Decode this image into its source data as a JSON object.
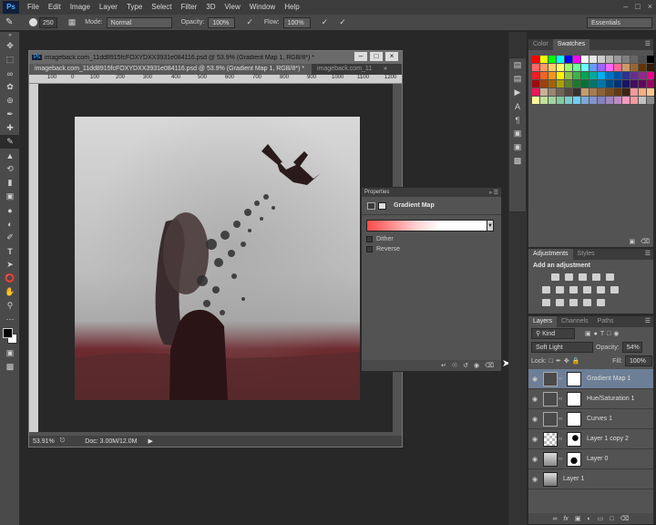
{
  "menu": {
    "logo": "Ps",
    "items": [
      "File",
      "Edit",
      "Image",
      "Layer",
      "Type",
      "Select",
      "Filter",
      "3D",
      "View",
      "Window",
      "Help"
    ]
  },
  "options": {
    "brush_size": "250",
    "mode_label": "Mode:",
    "mode_value": "Normal",
    "opacity_label": "Opacity:",
    "opacity_value": "100%",
    "flow_label": "Flow:",
    "flow_value": "100%",
    "workspace": "Essentials"
  },
  "document": {
    "window_title": "imageback.com_11dd8915fcFOXYDXX3931e084116.psd @ 53.9% (Gradient Map 1, RGB/8*) *",
    "tabs": [
      {
        "label": "imageback.com_11dd8915fcFOXYDXX3931e084116.psd @ 53.9% (Gradient Map 1, RGB/8*) *",
        "active": true
      },
      {
        "label": "imageback.com_11",
        "active": false
      }
    ],
    "ruler_ticks": [
      "100",
      "0",
      "100",
      "200",
      "300",
      "400",
      "500",
      "600",
      "700",
      "800",
      "900",
      "1000",
      "1100",
      "1200"
    ],
    "zoom": "53.91%",
    "doc_size": "Doc: 3.00M/12.0M"
  },
  "properties": {
    "panel_title": "Properties",
    "adjustment_name": "Gradient Map",
    "dither_label": "Dither",
    "reverse_label": "Reverse",
    "gradient_colors": [
      "#ff4a4a",
      "#ffffff"
    ]
  },
  "swatches_panel": {
    "tabs": [
      "Color",
      "Swatches"
    ],
    "active_tab": "Swatches",
    "colors": [
      "#ff0000",
      "#ffff00",
      "#00ff00",
      "#00ffff",
      "#0000ff",
      "#ff00ff",
      "#ffffff",
      "#e6e6e6",
      "#cccccc",
      "#b3b3b3",
      "#999999",
      "#808080",
      "#666666",
      "#4d4d4d",
      "#000000",
      "#ff6666",
      "#ff9966",
      "#ffcc66",
      "#ffff66",
      "#99ff66",
      "#66ff99",
      "#66ffff",
      "#6699ff",
      "#9966ff",
      "#ff66ff",
      "#ff6699",
      "#cc9966",
      "#996633",
      "#663300",
      "#331a00",
      "#ee1c24",
      "#f26522",
      "#f7941d",
      "#fff200",
      "#8dc63f",
      "#39b54a",
      "#00a651",
      "#00a99d",
      "#00aeef",
      "#0072bc",
      "#0054a6",
      "#2e3192",
      "#662d91",
      "#92278f",
      "#ec008c",
      "#9e0b0f",
      "#a0410d",
      "#a36209",
      "#aba000",
      "#598527",
      "#1a7b30",
      "#007236",
      "#00746b",
      "#0076a3",
      "#004a80",
      "#003471",
      "#1b1464",
      "#440e62",
      "#630460",
      "#9e005d",
      "#ed145b",
      "#c7b299",
      "#998675",
      "#736357",
      "#534741",
      "#37302d",
      "#c69c6d",
      "#a67c52",
      "#8c6239",
      "#754c24",
      "#603913",
      "#3c2415",
      "#f5989d",
      "#f9ad81",
      "#fdc68a",
      "#fff79a",
      "#c4df9b",
      "#a2d39c",
      "#82ca9c",
      "#7bcdc8",
      "#6ecff6",
      "#7da7d9",
      "#8393ca",
      "#8781bd",
      "#a186be",
      "#bd8cbf",
      "#f49ac1",
      "#f5989d",
      "#c2c2c2",
      "#8a8a8a"
    ]
  },
  "adjustments_panel": {
    "tabs": [
      "Adjustments",
      "Styles"
    ],
    "active_tab": "Adjustments",
    "heading": "Add an adjustment"
  },
  "layers_panel": {
    "tabs": [
      "Layers",
      "Channels",
      "Paths"
    ],
    "active_tab": "Layers",
    "filter_kind": "Kind",
    "blend_mode": "Soft Light",
    "opacity_label": "Opacity:",
    "opacity_value": "54%",
    "lock_label": "Lock:",
    "fill_label": "Fill:",
    "fill_value": "100%",
    "layers": [
      {
        "name": "Gradient Map 1",
        "selected": true
      },
      {
        "name": "Hue/Saturation 1",
        "selected": false
      },
      {
        "name": "Curves 1",
        "selected": false
      },
      {
        "name": "Layer 1 copy 2",
        "selected": false
      },
      {
        "name": "Layer 0",
        "selected": false
      },
      {
        "name": "Layer 1",
        "selected": false
      }
    ]
  }
}
